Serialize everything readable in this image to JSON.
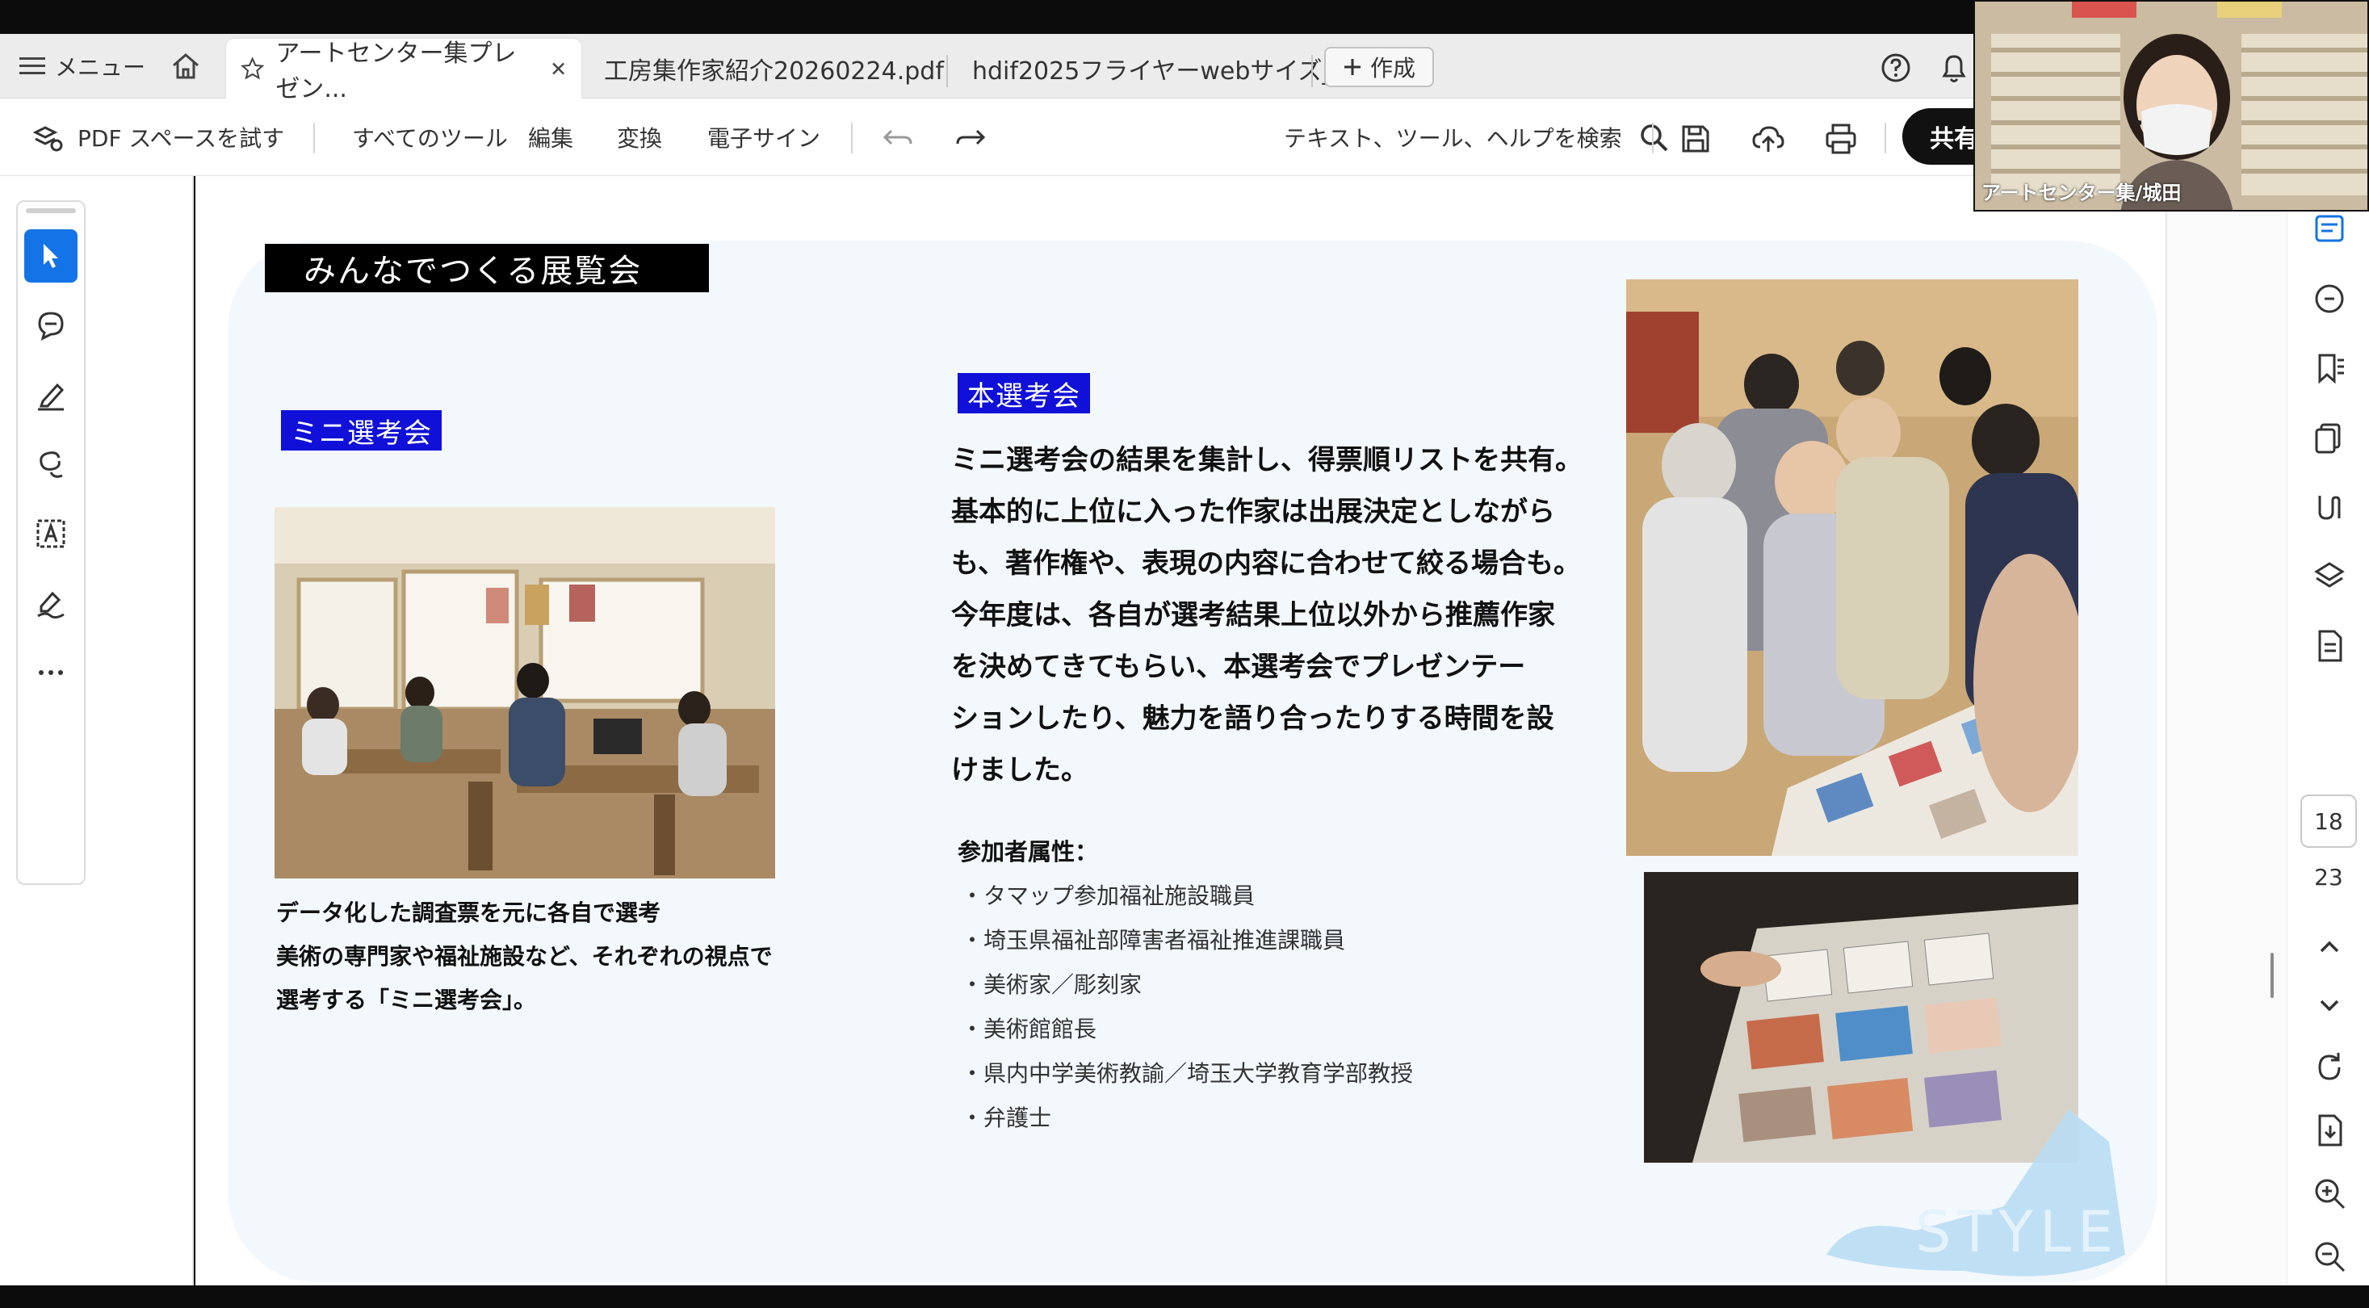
{
  "tabbar": {
    "menu_label": "メニュー",
    "tabs": [
      {
        "label": "アートセンター集プレゼン..."
      },
      {
        "label": "工房集作家紹介20260224.pdf"
      },
      {
        "label": "hdif2025フライヤーwebサイズ_..."
      }
    ],
    "create_label": "作成"
  },
  "toolbar": {
    "try_spaces": "PDF スペースを試す",
    "all_tools": "すべてのツール",
    "edit": "編集",
    "convert": "変換",
    "esign": "電子サイン",
    "search_placeholder": "テキスト、ツール、ヘルプを検索",
    "share_label": "共有"
  },
  "document": {
    "section_title": "みんなでつくる展覧会",
    "mini_label": "ミニ選考会",
    "mini_caption": [
      "データ化した調査票を元に各自で選考",
      "美術の専門家や福祉施設など、それぞれの視点で",
      "選考する「ミニ選考会」。"
    ],
    "main_label": "本選考会",
    "main_text": [
      "ミニ選考会の結果を集計し、得票順リストを共有。",
      "基本的に上位に入った作家は出展決定としながら",
      "も、著作権や、表現の内容に合わせて絞る場合も。",
      "今年度は、各自が選考結果上位以外から推薦作家",
      "を決めてきてもらい、本選考会でプレゼンテー",
      "ションしたり、魅力を語り合ったりする時間を設",
      "けました。"
    ],
    "attributes_title": "参加者属性：",
    "attributes": [
      "・タマップ参加福祉施設職員",
      "・埼玉県福祉部障害者福祉推進課職員",
      "・美術家／彫刻家",
      "・美術館館長",
      "・県内中学美術教諭／埼玉大学教育学部教授",
      "・弁護士"
    ],
    "watermark_text": "STYLE"
  },
  "pagination": {
    "current": "18",
    "total": "23"
  },
  "webcam": {
    "name": "アートセンター集/城田"
  },
  "colors": {
    "label_blue": "#1010d8",
    "accent_blue": "#1473e6",
    "page_bg": "#f3f8fd"
  }
}
